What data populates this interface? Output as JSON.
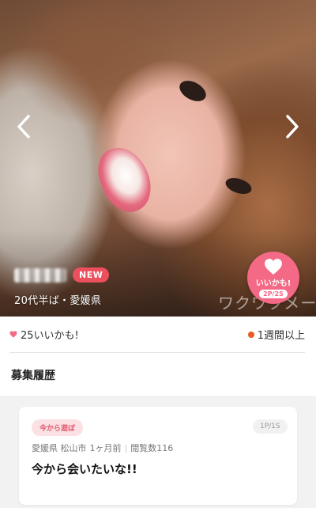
{
  "profile": {
    "new_badge": "NEW",
    "age_location": "20代半ば・愛媛県",
    "watermark": "ワクワクメール"
  },
  "like_button": {
    "label": "いいかも!",
    "count": "2P/2S"
  },
  "stats": {
    "likes": "25いいかも!",
    "last_login": "1週間以上"
  },
  "section": {
    "title": "募集履歴"
  },
  "history": [
    {
      "tag": "今から遊ぼ",
      "pager": "1P/1S",
      "location": "愛媛県 松山市",
      "time": "1ヶ月前",
      "views": "閲覧数116",
      "title": "今から会いたいな!!"
    }
  ],
  "colors": {
    "accent_pink": "#f46a86",
    "new_badge_red": "#ec4f5d",
    "status_orange": "#ea5a22"
  },
  "icons": {
    "prev": "chevron-left-icon",
    "next": "chevron-right-icon",
    "heart": "heart-icon",
    "status": "status-dot-icon"
  }
}
